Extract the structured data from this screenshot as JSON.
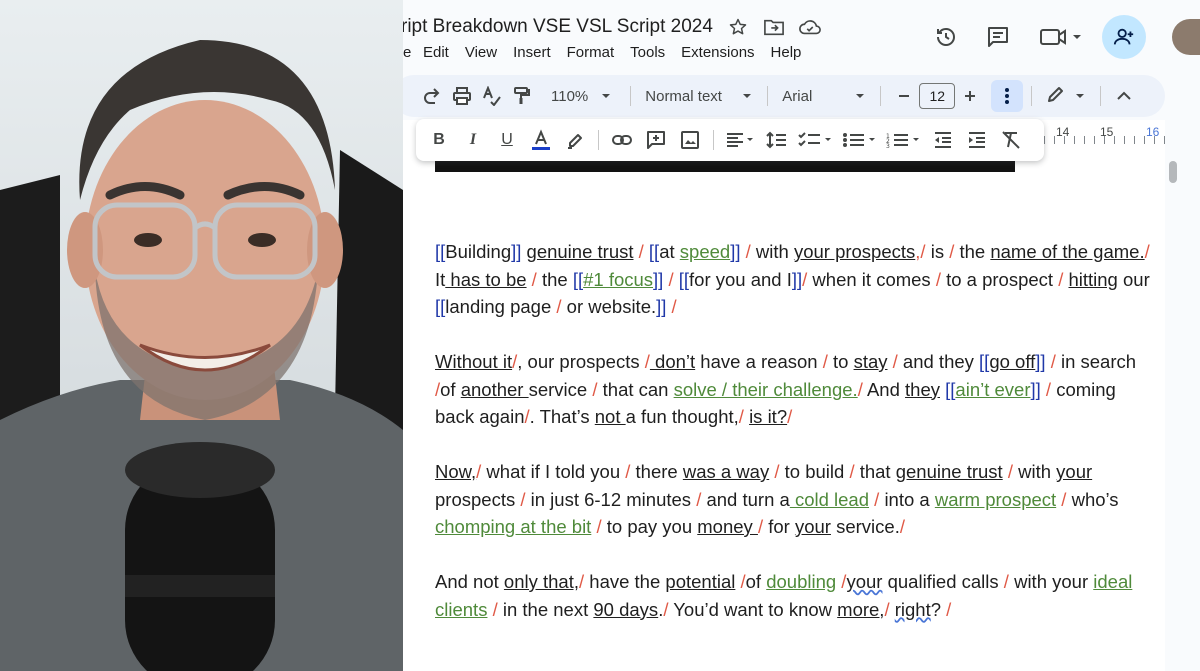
{
  "window": {
    "doc_title": "ript Breakdown VSE VSL Script 2024",
    "menus": [
      "e",
      "Edit",
      "View",
      "Insert",
      "Format",
      "Tools",
      "Extensions",
      "Help"
    ]
  },
  "toolbar": {
    "zoom": "110%",
    "style": "Normal text",
    "font": "Arial",
    "font_size": "12",
    "ruler_labels": [
      "14",
      "15",
      "16"
    ]
  },
  "colors": {
    "accent_blue": "#c2e7ff",
    "link_green": "#4f8a3a",
    "bracket_blue": "#2038a8",
    "slash_red": "#e05a47"
  },
  "icons": {
    "title": [
      "star-icon",
      "move-to-folder-icon",
      "cloud-status-icon"
    ],
    "actions": [
      "version-history-icon",
      "comments-icon",
      "meet-icon",
      "share-add-person-icon"
    ]
  },
  "paragraphs": [
    [
      {
        "t": "[[",
        "s": "b"
      },
      {
        "t": "Building"
      },
      {
        "t": "]]",
        "s": "b"
      },
      {
        "t": " "
      },
      {
        "t": "genuine trust",
        "s": "u"
      },
      {
        "t": " / ",
        "s": "s"
      },
      {
        "t": "[[",
        "s": "b"
      },
      {
        "t": "at "
      },
      {
        "t": "speed",
        "s": "g"
      },
      {
        "t": "]]",
        "s": "b"
      },
      {
        "t": " / ",
        "s": "s"
      },
      {
        "t": "with "
      },
      {
        "t": "your prospects",
        "s": "u"
      },
      {
        "t": ",/",
        "s": "s"
      },
      {
        "t": " is "
      },
      {
        "t": "/ ",
        "s": "s"
      },
      {
        "t": "the "
      },
      {
        "t": "name of the game.",
        "s": "u"
      },
      {
        "t": "/",
        "s": "s"
      },
      {
        "t": " It"
      },
      {
        "t": " has to be",
        "s": "u"
      },
      {
        "t": " / ",
        "s": "s"
      },
      {
        "t": "the "
      },
      {
        "t": "[[",
        "s": "b"
      },
      {
        "t": "#1 focus",
        "s": "g"
      },
      {
        "t": "]]",
        "s": "b"
      },
      {
        "t": " / ",
        "s": "s"
      },
      {
        "t": "[[",
        "s": "b"
      },
      {
        "t": "for you and I"
      },
      {
        "t": "]]",
        "s": "b"
      },
      {
        "t": "/",
        "s": "s"
      },
      {
        "t": " when it comes "
      },
      {
        "t": "/ ",
        "s": "s"
      },
      {
        "t": "to a prospect "
      },
      {
        "t": "/ ",
        "s": "s"
      },
      {
        "t": "hitting",
        "s": "u"
      },
      {
        "t": " our "
      },
      {
        "t": "[[",
        "s": "b"
      },
      {
        "t": "landing page "
      },
      {
        "t": "/ ",
        "s": "s"
      },
      {
        "t": "or website."
      },
      {
        "t": "]]",
        "s": "b"
      },
      {
        "t": " /",
        "s": "s"
      }
    ],
    [
      {
        "t": "Without it",
        "s": "u"
      },
      {
        "t": "/",
        "s": "s"
      },
      {
        "t": ", our prospects "
      },
      {
        "t": "/",
        "s": "s"
      },
      {
        "t": " don’t",
        "s": "u"
      },
      {
        "t": " have a reason "
      },
      {
        "t": "/ ",
        "s": "s"
      },
      {
        "t": "to "
      },
      {
        "t": "stay",
        "s": "u"
      },
      {
        "t": " / ",
        "s": "s"
      },
      {
        "t": "and they "
      },
      {
        "t": "[[",
        "s": "b"
      },
      {
        "t": "go off",
        "s": "u"
      },
      {
        "t": "]]",
        "s": "b"
      },
      {
        "t": " /",
        "s": "s"
      },
      {
        "t": " in search "
      },
      {
        "t": "/",
        "s": "s"
      },
      {
        "t": "of "
      },
      {
        "t": "another ",
        "s": "u"
      },
      {
        "t": "service "
      },
      {
        "t": "/ ",
        "s": "s"
      },
      {
        "t": "that can "
      },
      {
        "t": "solve / their challenge.",
        "s": "g"
      },
      {
        "t": "/",
        "s": "s"
      },
      {
        "t": " And "
      },
      {
        "t": "they",
        "s": "u"
      },
      {
        "t": " "
      },
      {
        "t": "[[",
        "s": "b"
      },
      {
        "t": "ain’t ever",
        "s": "g"
      },
      {
        "t": "]]",
        "s": "b"
      },
      {
        "t": " / ",
        "s": "s"
      },
      {
        "t": "coming back again"
      },
      {
        "t": "/",
        "s": "s"
      },
      {
        "t": ". That’s "
      },
      {
        "t": "not ",
        "s": "u"
      },
      {
        "t": "a fun thought,"
      },
      {
        "t": "/",
        "s": "s"
      },
      {
        "t": " "
      },
      {
        "t": "is it?",
        "s": "u"
      },
      {
        "t": "/",
        "s": "s"
      }
    ],
    [
      {
        "t": "Now,",
        "s": "u"
      },
      {
        "t": "/",
        "s": "s"
      },
      {
        "t": " what if I told you "
      },
      {
        "t": "/ ",
        "s": "s"
      },
      {
        "t": "there "
      },
      {
        "t": "was a way",
        "s": "u"
      },
      {
        "t": " / ",
        "s": "s"
      },
      {
        "t": "to build "
      },
      {
        "t": "/ ",
        "s": "s"
      },
      {
        "t": "that "
      },
      {
        "t": "genuine trust",
        "s": "u"
      },
      {
        "t": " / ",
        "s": "s"
      },
      {
        "t": "with "
      },
      {
        "t": "your",
        "s": "u"
      },
      {
        "t": " prospects "
      },
      {
        "t": "/ ",
        "s": "s"
      },
      {
        "t": "in just 6-12 minutes "
      },
      {
        "t": "/ ",
        "s": "s"
      },
      {
        "t": "and turn a"
      },
      {
        "t": " cold lead",
        "s": "g"
      },
      {
        "t": " / ",
        "s": "s"
      },
      {
        "t": "into a "
      },
      {
        "t": "warm prospect",
        "s": "g"
      },
      {
        "t": " / ",
        "s": "s"
      },
      {
        "t": "who’s "
      },
      {
        "t": "chomping at the bit",
        "s": "g"
      },
      {
        "t": " / ",
        "s": "s"
      },
      {
        "t": "to pay you "
      },
      {
        "t": "money ",
        "s": "u"
      },
      {
        "t": "/",
        "s": "s"
      },
      {
        "t": " for "
      },
      {
        "t": "your",
        "s": "u"
      },
      {
        "t": " service."
      },
      {
        "t": "/",
        "s": "s"
      }
    ],
    [
      {
        "t": "And not "
      },
      {
        "t": "only that,",
        "s": "u"
      },
      {
        "t": "/",
        "s": "s"
      },
      {
        "t": " have the "
      },
      {
        "t": "potential",
        "s": "u"
      },
      {
        "t": " /",
        "s": "s"
      },
      {
        "t": "of "
      },
      {
        "t": "doubling",
        "s": "g"
      },
      {
        "t": " /",
        "s": "s"
      },
      {
        "t": "your",
        "s": "sq"
      },
      {
        "t": " qualified calls "
      },
      {
        "t": "/ ",
        "s": "s"
      },
      {
        "t": "with your "
      },
      {
        "t": "ideal clients",
        "s": "g"
      },
      {
        "t": " / ",
        "s": "s"
      },
      {
        "t": "in the next "
      },
      {
        "t": "90 days",
        "s": "u"
      },
      {
        "t": ".",
        "s": ""
      },
      {
        "t": "/",
        "s": "s"
      },
      {
        "t": " You’d want to know "
      },
      {
        "t": "more,",
        "s": "u"
      },
      {
        "t": "/",
        "s": "s"
      },
      {
        "t": " "
      },
      {
        "t": "right",
        "s": "sq"
      },
      {
        "t": "? "
      },
      {
        "t": "/",
        "s": "s"
      }
    ]
  ]
}
